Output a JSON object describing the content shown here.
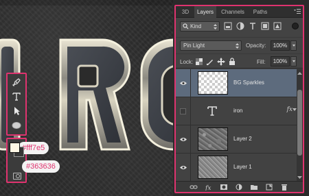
{
  "colors": {
    "foreground": "#fff7e5",
    "background": "#363636",
    "accent_outline": "#e0336f",
    "label_text": "#e0336f",
    "selected_layer": "#5d6b7d"
  },
  "color_labels": {
    "foreground": "#fff7e5",
    "background": "#363636"
  },
  "tools": [
    {
      "icon": "pen-tool-icon"
    },
    {
      "icon": "type-tool-icon"
    },
    {
      "icon": "path-selection-icon"
    },
    {
      "icon": "ellipse-tool-icon"
    }
  ],
  "panel": {
    "tabs": [
      "3D",
      "Layers",
      "Channels",
      "Paths"
    ],
    "active_tab": "Layers",
    "filter_kind": "Kind",
    "blend_mode": "Pin Light",
    "opacity_label": "Opacity:",
    "opacity_value": "100%",
    "lock_label": "Lock:",
    "fill_label": "Fill:",
    "fill_value": "100%"
  },
  "layers": [
    {
      "name": "BG Sparkles",
      "visible": true,
      "selected": true,
      "thumb": "transparent",
      "fx": false
    },
    {
      "name": "iron",
      "visible": false,
      "selected": false,
      "thumb": "type",
      "fx": true
    },
    {
      "name": "Layer 2",
      "visible": true,
      "selected": false,
      "thumb": "stone",
      "fx": false
    },
    {
      "name": "Layer 1",
      "visible": true,
      "selected": false,
      "thumb": "metal",
      "fx": false
    }
  ],
  "bottom_icons": [
    "link-layers-icon",
    "fx-icon",
    "layer-mask-icon",
    "adjustment-layer-icon",
    "new-group-icon",
    "new-layer-icon",
    "delete-layer-icon"
  ]
}
